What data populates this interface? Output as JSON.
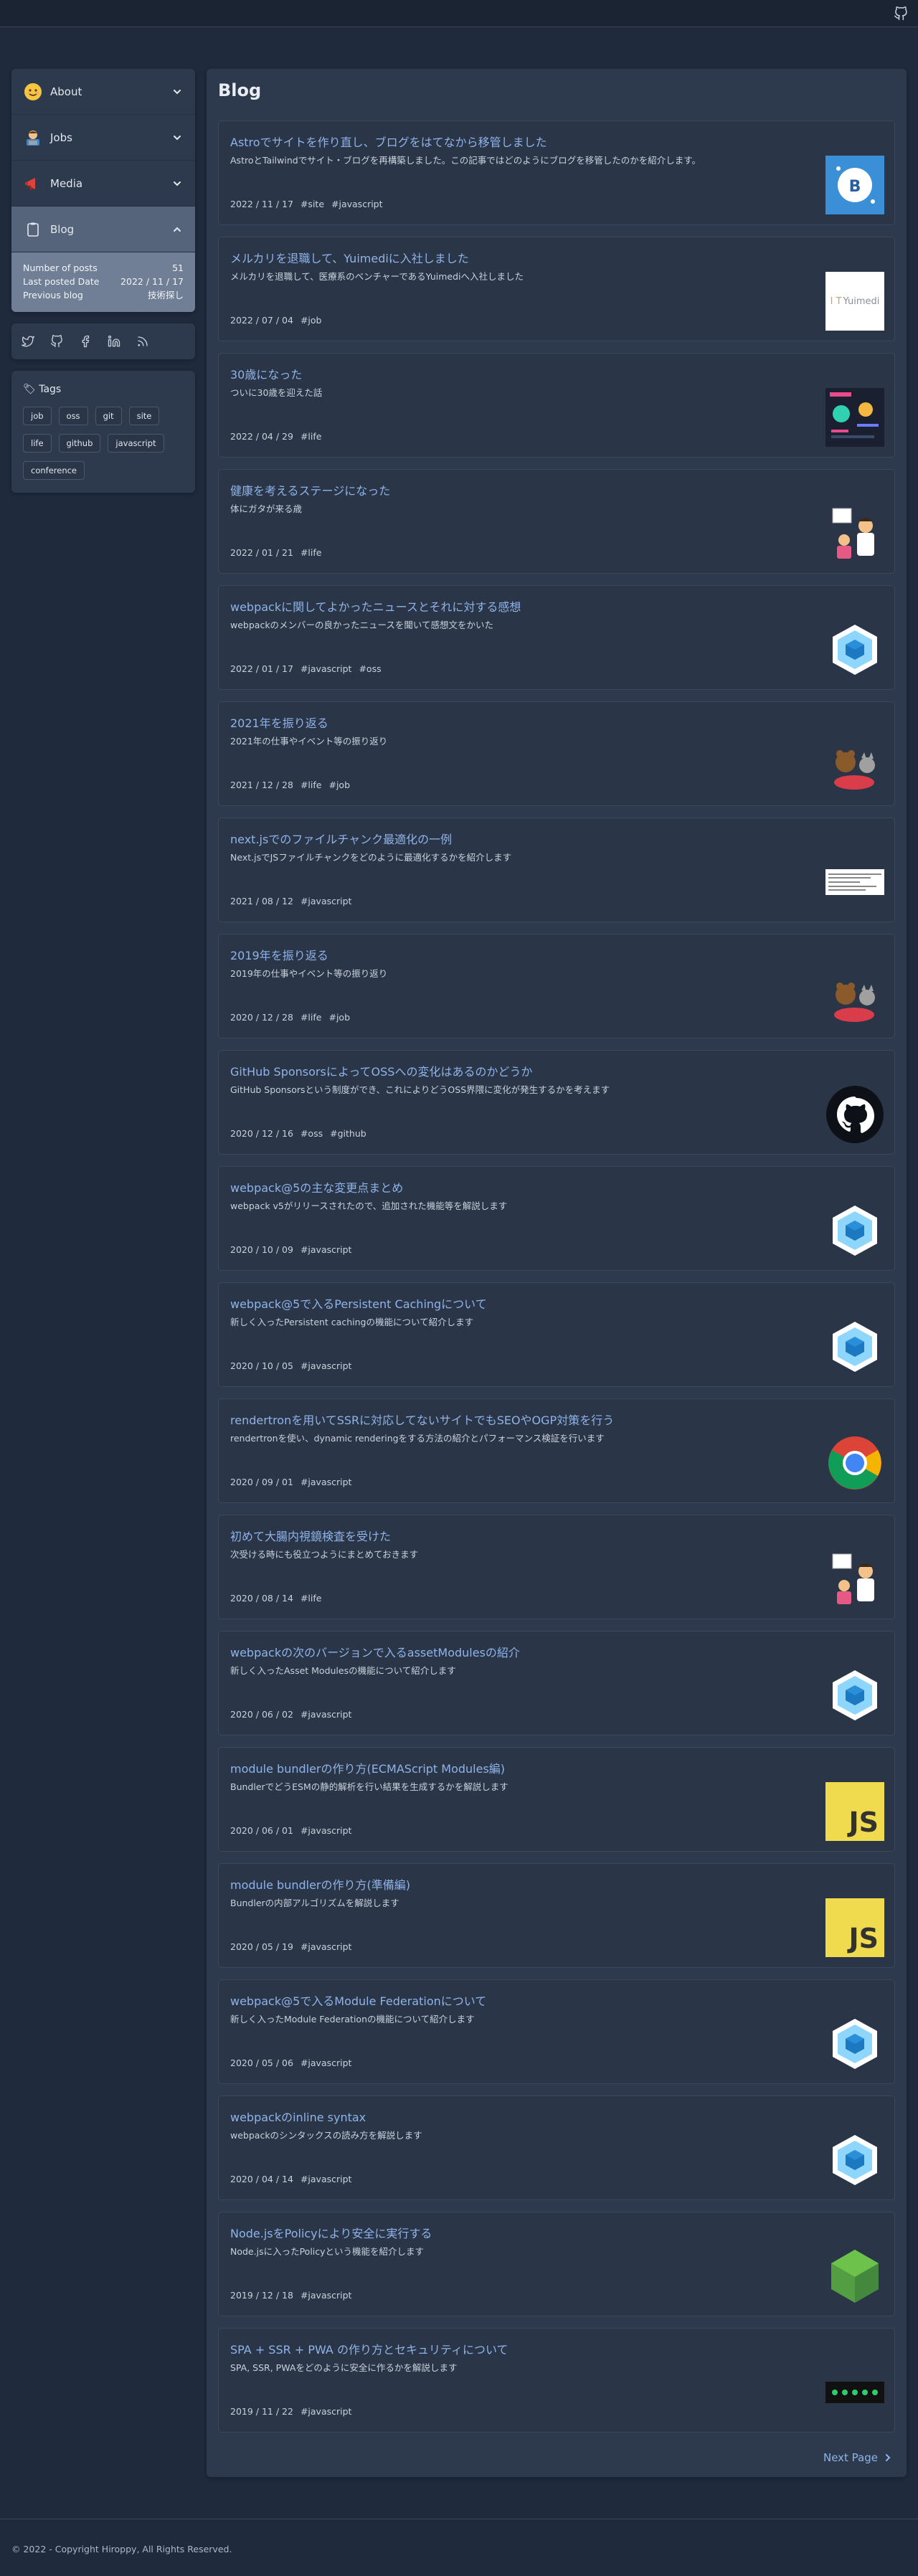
{
  "colors": {
    "background": "#1f2a3c",
    "card": "#2d3a4d",
    "link": "#8fb3e8",
    "active_menu": "#55647a"
  },
  "header": {
    "github_icon": "github-icon"
  },
  "sidebar": {
    "menu": [
      {
        "label": "About",
        "icon": "smiling-face-icon"
      },
      {
        "label": "Jobs",
        "icon": "technologist-icon"
      },
      {
        "label": "Media",
        "icon": "megaphone-icon"
      },
      {
        "label": "Blog",
        "icon": "clipboard-icon"
      }
    ],
    "blog_info": [
      {
        "key": "Number of posts",
        "value": "51"
      },
      {
        "key": "Last posted Date",
        "value": "2022 / 11 / 17"
      },
      {
        "key": "Previous blog",
        "value": "技術探し"
      }
    ],
    "social": [
      "twitter-icon",
      "github-icon",
      "facebook-icon",
      "linkedin-icon",
      "rss-icon"
    ],
    "tags_title": "🏷 Tags",
    "tags": [
      "job",
      "oss",
      "git",
      "site",
      "life",
      "github",
      "javascript",
      "conference"
    ]
  },
  "main": {
    "title": "Blog",
    "posts": [
      {
        "title": "Astroでサイトを作り直し、ブログをはてなから移管しました",
        "desc": "AstroとTailwindでサイト・ブログを再構築しました。この記事ではどのようにブログを移管したのかを紹介します。",
        "date": "2022 / 11 / 17",
        "tags": [
          "#site",
          "#javascript"
        ],
        "thumb": "astro-image"
      },
      {
        "title": "メルカリを退職して、Yuimediに入社しました",
        "desc": "メルカリを退職して、医療系のベンチャーであるYuimediへ入社しました",
        "date": "2022 / 07 / 04",
        "tags": [
          "#job"
        ],
        "thumb": "yuimedi-logo",
        "thumb_text": "Yuimedi"
      },
      {
        "title": "30歳になった",
        "desc": "ついに30歳を迎えた話",
        "date": "2022 / 04 / 29",
        "tags": [
          "#life"
        ],
        "thumb": "dashboard-image"
      },
      {
        "title": "健康を考えるステージになった",
        "desc": "体にガタが来る歳",
        "date": "2022 / 01 / 21",
        "tags": [
          "#life"
        ],
        "thumb": "doctor-illustration"
      },
      {
        "title": "webpackに関してよかったニュースとそれに対する感想",
        "desc": "webpackのメンバーの良かったニュースを聞いて感想文をかいた",
        "date": "2022 / 01 / 17",
        "tags": [
          "#javascript",
          "#oss"
        ],
        "thumb": "webpack-logo"
      },
      {
        "title": "2021年を振り返る",
        "desc": "2021年の仕事やイベント等の振り返り",
        "date": "2021 / 12 / 28",
        "tags": [
          "#life",
          "#job"
        ],
        "thumb": "animals-illustration"
      },
      {
        "title": "next.jsでのファイルチャンク最適化の一例",
        "desc": "Next.jsでJSファイルチャンクをどのように最適化するかを紹介します",
        "date": "2021 / 08 / 12",
        "tags": [
          "#javascript"
        ],
        "thumb": "code-screenshot"
      },
      {
        "title": "2019年を振り返る",
        "desc": "2019年の仕事やイベント等の振り返り",
        "date": "2020 / 12 / 28",
        "tags": [
          "#life",
          "#job"
        ],
        "thumb": "animals-illustration"
      },
      {
        "title": "GitHub SponsorsによってOSSへの変化はあるのかどうか",
        "desc": "GitHub Sponsorsという制度ができ、これによりどうOSS界隈に変化が発生するかを考えます",
        "date": "2020 / 12 / 16",
        "tags": [
          "#oss",
          "#github"
        ],
        "thumb": "github-logo"
      },
      {
        "title": "webpack@5の主な変更点まとめ",
        "desc": "webpack v5がリリースされたので、追加された機能等を解説します",
        "date": "2020 / 10 / 09",
        "tags": [
          "#javascript"
        ],
        "thumb": "webpack-logo"
      },
      {
        "title": "webpack@5で入るPersistent Cachingについて",
        "desc": "新しく入ったPersistent cachingの機能について紹介します",
        "date": "2020 / 10 / 05",
        "tags": [
          "#javascript"
        ],
        "thumb": "webpack-logo"
      },
      {
        "title": "rendertronを用いてSSRに対応してないサイトでもSEOやOGP対策を行う",
        "desc": "rendertronを使い、dynamic renderingをする方法の紹介とパフォーマンス検証を行います",
        "date": "2020 / 09 / 01",
        "tags": [
          "#javascript"
        ],
        "thumb": "chrome-logo"
      },
      {
        "title": "初めて大腸内視鏡検査を受けた",
        "desc": "次受ける時にも役立つようにまとめておきます",
        "date": "2020 / 08 / 14",
        "tags": [
          "#life"
        ],
        "thumb": "doctor-illustration"
      },
      {
        "title": "webpackの次のバージョンで入るassetModulesの紹介",
        "desc": "新しく入ったAsset Modulesの機能について紹介します",
        "date": "2020 / 06 / 02",
        "tags": [
          "#javascript"
        ],
        "thumb": "webpack-logo"
      },
      {
        "title": "module bundlerの作り方(ECMAScript Modules編)",
        "desc": "BundlerでどうESMの静的解析を行い結果を生成するかを解説します",
        "date": "2020 / 06 / 01",
        "tags": [
          "#javascript"
        ],
        "thumb": "js-logo",
        "thumb_text": "JS"
      },
      {
        "title": "module bundlerの作り方(準備編)",
        "desc": "Bundlerの内部アルゴリズムを解説します",
        "date": "2020 / 05 / 19",
        "tags": [
          "#javascript"
        ],
        "thumb": "js-logo",
        "thumb_text": "JS"
      },
      {
        "title": "webpack@5で入るModule Federationについて",
        "desc": "新しく入ったModule Federationの機能について紹介します",
        "date": "2020 / 05 / 06",
        "tags": [
          "#javascript"
        ],
        "thumb": "webpack-logo"
      },
      {
        "title": "webpackのinline syntax",
        "desc": "webpackのシンタックスの読み方を解説します",
        "date": "2020 / 04 / 14",
        "tags": [
          "#javascript"
        ],
        "thumb": "webpack-logo"
      },
      {
        "title": "Node.jsをPolicyにより安全に実行する",
        "desc": "Node.jsに入ったPolicyという機能を紹介します",
        "date": "2019 / 12 / 18",
        "tags": [
          "#javascript"
        ],
        "thumb": "nodejs-logo"
      },
      {
        "title": "SPA + SSR + PWA の作り方とセキュリティについて",
        "desc": "SPA, SSR, PWAをどのように安全に作るかを解説します",
        "date": "2019 / 11 / 22",
        "tags": [
          "#javascript"
        ],
        "thumb": "terminal-screenshot"
      }
    ],
    "next_page": "Next Page"
  },
  "footer": {
    "copyright": "© 2022 - Copyright Hiroppy, All Rights Reserved."
  }
}
